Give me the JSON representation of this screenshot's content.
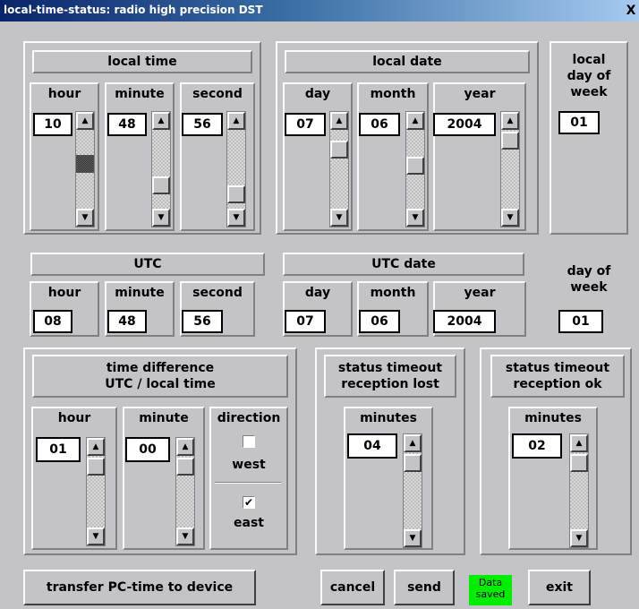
{
  "window": {
    "title": "local-time-status: radio high precision DST",
    "close_glyph": "X"
  },
  "local_time": {
    "header": "local time",
    "hour": {
      "label": "hour",
      "value": "10"
    },
    "minute": {
      "label": "minute",
      "value": "48"
    },
    "second": {
      "label": "second",
      "value": "56"
    }
  },
  "local_date": {
    "header": "local date",
    "day": {
      "label": "day",
      "value": "07"
    },
    "month": {
      "label": "month",
      "value": "06"
    },
    "year": {
      "label": "year",
      "value": "2004"
    }
  },
  "local_dow": {
    "header": "local\nday of\nweek",
    "value": "01"
  },
  "utc_time": {
    "header": "UTC",
    "hour": {
      "label": "hour",
      "value": "08"
    },
    "minute": {
      "label": "minute",
      "value": "48"
    },
    "second": {
      "label": "second",
      "value": "56"
    }
  },
  "utc_date": {
    "header": "UTC date",
    "day": {
      "label": "day",
      "value": "07"
    },
    "month": {
      "label": "month",
      "value": "06"
    },
    "year": {
      "label": "year",
      "value": "2004"
    }
  },
  "utc_dow": {
    "header": "day of\nweek",
    "value": "01"
  },
  "time_diff": {
    "header": "time difference\nUTC / local time",
    "hour": {
      "label": "hour",
      "value": "01"
    },
    "minute": {
      "label": "minute",
      "value": "00"
    },
    "direction": {
      "label": "direction",
      "west": "west",
      "east": "east",
      "west_checked": false,
      "east_checked": true
    }
  },
  "timeout_lost": {
    "header": "status timeout\nreception lost",
    "minutes_label": "minutes",
    "value": "04"
  },
  "timeout_ok": {
    "header": "status timeout\nreception ok",
    "minutes_label": "minutes",
    "value": "02"
  },
  "glyphs": {
    "up": "▲",
    "down": "▼",
    "check": "✔"
  },
  "buttons": {
    "transfer": "transfer PC-time to device",
    "cancel": "cancel",
    "send": "send",
    "exit": "exit"
  },
  "status": {
    "text": "Data\nsaved",
    "color": "#00ee00"
  }
}
